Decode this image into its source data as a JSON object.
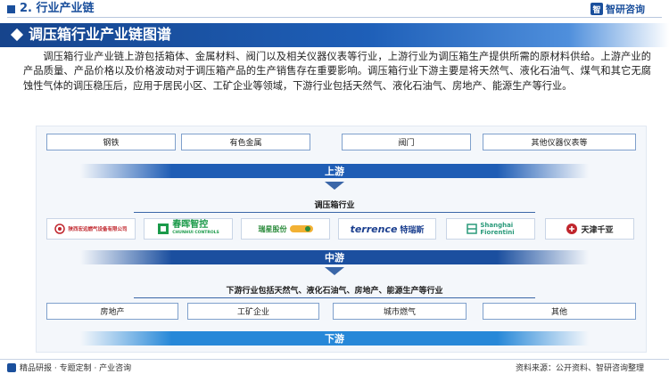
{
  "header": {
    "section": "2. 行业产业链",
    "brand": "智研咨询",
    "brand_mark": "智"
  },
  "title": "调压箱行业产业链图谱",
  "paragraph": "调压箱行业产业链上游包括箱体、金属材料、阀门以及相关仪器仪表等行业，上游行业为调压箱生产提供所需的原材料供给。上游产业的产品质量、产品价格以及价格波动对于调压箱产品的生产销售存在重要影响。调压箱行业下游主要是将天然气、液化石油气、煤气和其它无腐蚀性气体的调压稳压后，应用于居民小区、工矿企业等领域，下游行业包括天然气、液化石油气、房地产、能源生产等行业。",
  "upstream": {
    "items": [
      "钢铁",
      "有色金属",
      "阀门",
      "其他仪器仪表等"
    ],
    "band": "上游"
  },
  "midstream": {
    "label": "调压箱行业",
    "companies": [
      {
        "name": "陕西宏远燃气设备有限公司",
        "color": "#c0262d"
      },
      {
        "name": "春晖智控",
        "sub": "CHUNHUI CONTROLS",
        "color": "#1b9a4a"
      },
      {
        "name": "瑞星股份",
        "color": "#2a8a3a"
      },
      {
        "name": "terrence",
        "sub": "特瑞斯",
        "color": "#1b3f8f"
      },
      {
        "name": "Shanghai",
        "sub": "Fiorentini",
        "color": "#2a9a7a"
      },
      {
        "name": "天津千亚",
        "color": "#c0262d"
      }
    ],
    "band": "中游"
  },
  "downstream": {
    "label": "下游行业包括天然气、液化石油气、房地产、能源生产等行业",
    "items": [
      "房地产",
      "工矿企业",
      "城市燃气",
      "其他"
    ],
    "band": "下游"
  },
  "footer": {
    "left": "精品研报 · 专题定制 · 产业咨询",
    "right": "资料来源：公开资料、智研咨询整理"
  }
}
